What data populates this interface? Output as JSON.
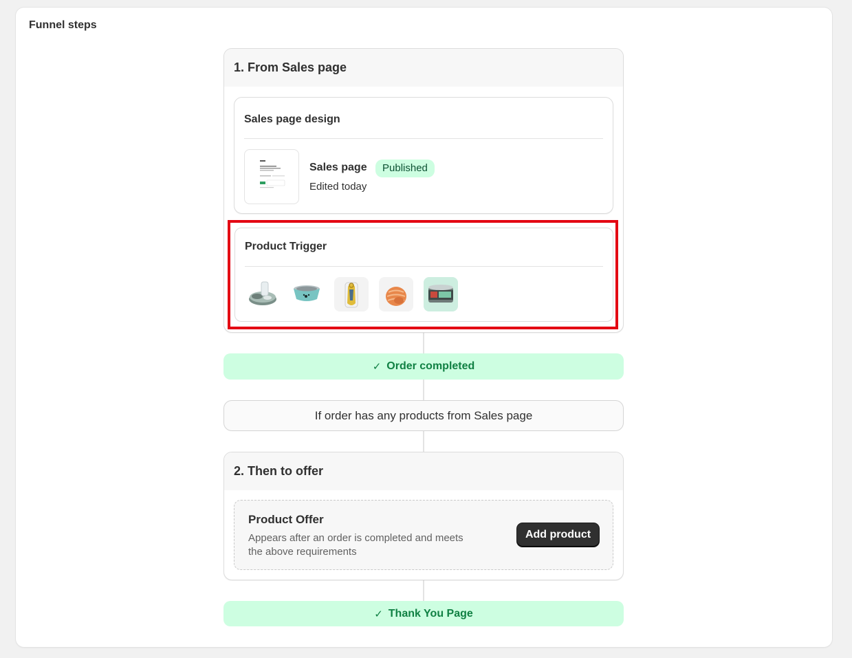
{
  "section_title": "Funnel steps",
  "step1": {
    "title": "1. From Sales page",
    "design_card": {
      "title": "Sales page design",
      "page_name": "Sales page",
      "status": "Published",
      "meta": "Edited today"
    },
    "trigger_card": {
      "title": "Product Trigger",
      "products": [
        {
          "icon": "pet-water-fountain-icon"
        },
        {
          "icon": "pet-bowl-icon"
        },
        {
          "icon": "leash-product-icon"
        },
        {
          "icon": "cat-scratcher-icon"
        },
        {
          "icon": "pet-food-can-icon"
        }
      ]
    }
  },
  "order_completed": {
    "label": "Order completed",
    "icon": "check-icon"
  },
  "condition": {
    "label": "If order has any products from Sales page"
  },
  "step2": {
    "title": "2. Then to offer",
    "offer": {
      "title": "Product Offer",
      "description": "Appears after an order is completed and meets the above requirements",
      "button_label": "Add product"
    }
  },
  "thank_you": {
    "label": "Thank You Page",
    "icon": "check-icon"
  },
  "colors": {
    "success_bg": "#cdfee1",
    "success_text": "#108043",
    "highlight": "#e30613",
    "primary_button": "#303030"
  }
}
